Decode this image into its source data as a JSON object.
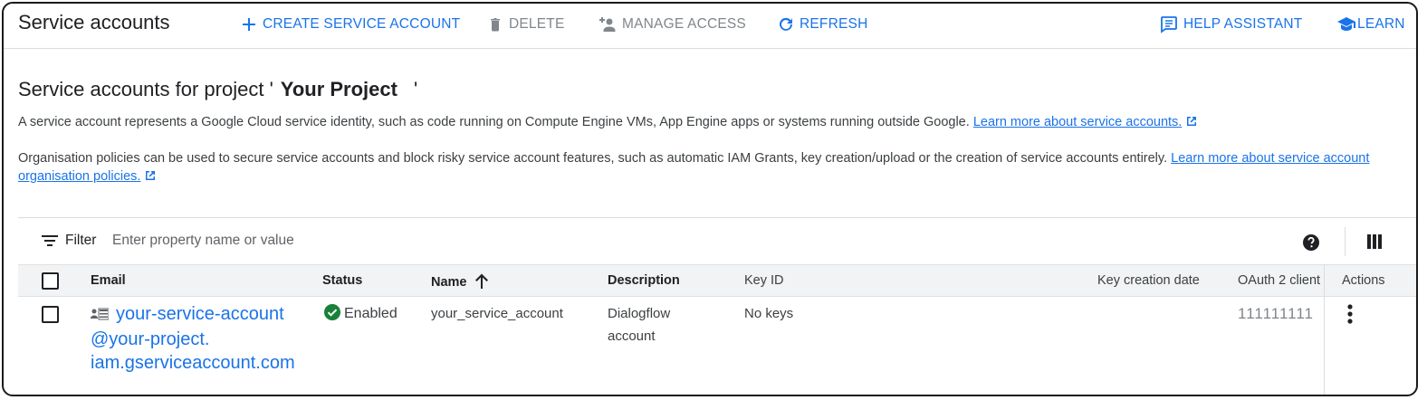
{
  "header": {
    "title": "Service accounts",
    "create_label": "CREATE SERVICE ACCOUNT",
    "delete_label": "DELETE",
    "manage_access_label": "MANAGE ACCESS",
    "refresh_label": "REFRESH",
    "help_label": "HELP ASSISTANT",
    "learn_label": "LEARN"
  },
  "main": {
    "heading_prefix": "Service accounts for project '",
    "project_name": "Your Project",
    "heading_suffix": "'",
    "desc1_text": "A service account represents a Google Cloud service identity, such as code running on Compute Engine VMs, App Engine apps or systems running outside Google.",
    "desc1_link": "Learn more about service accounts.",
    "desc2_text": "Organisation policies can be used to secure service accounts and block risky service account features, such as automatic IAM Grants, key creation/upload or the creation of service accounts entirely.",
    "desc2_link": "Learn more about service account organisation policies."
  },
  "filter": {
    "label": "Filter",
    "placeholder": "Enter property name or value"
  },
  "table": {
    "columns": {
      "email": "Email",
      "status": "Status",
      "name": "Name",
      "description": "Description",
      "key_id": "Key ID",
      "key_creation_date": "Key creation date",
      "oauth": "OAuth 2 client",
      "actions": "Actions"
    },
    "rows": [
      {
        "email_line1": "your-service-account",
        "email_line2": "@your-project.",
        "email_line3": "iam.gserviceaccount.com",
        "status": "Enabled",
        "name": "your_service_account",
        "description_line1": "Dialogflow",
        "description_line2": "account",
        "key_id": "No keys",
        "oauth_client": "111111111"
      }
    ]
  },
  "colors": {
    "accent": "#1a73e8",
    "status_ok": "#188038",
    "header_bg": "#f1f3f4"
  },
  "icons": {
    "create": "plus-icon",
    "delete": "trash-icon",
    "manage_access": "person-add-icon",
    "refresh": "refresh-icon",
    "help": "chat-icon",
    "learn": "school-icon",
    "filter": "filter-icon",
    "help_circle": "help-circle-icon",
    "columns": "column-display-icon",
    "sort": "arrow-up-icon",
    "status": "check-circle-icon",
    "account": "service-account-icon",
    "actions": "more-vert-icon",
    "external": "open-in-new-icon"
  }
}
